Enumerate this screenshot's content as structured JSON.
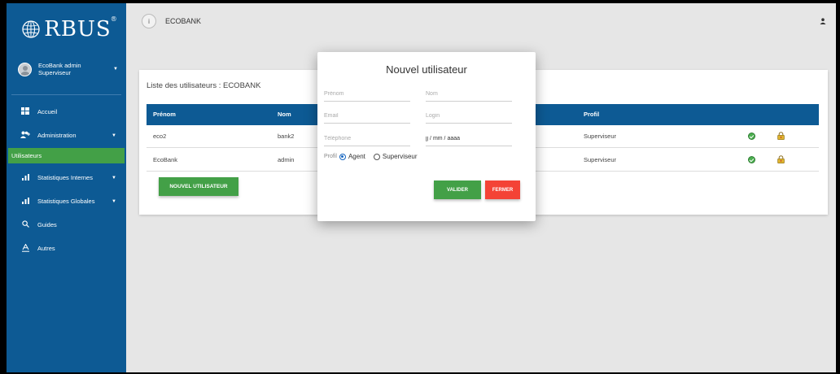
{
  "brand": {
    "logo_text": "RBUS",
    "trademark": "®"
  },
  "user": {
    "name": "EcoBank admin",
    "role": "Superviseur"
  },
  "sidebar": {
    "items": [
      {
        "label": "Accueil"
      },
      {
        "label": "Administration"
      },
      {
        "label": "Utilisateurs"
      },
      {
        "label": "Statistiques Internes"
      },
      {
        "label": "Statistiques Globales"
      },
      {
        "label": "Guides"
      },
      {
        "label": "Autres"
      }
    ]
  },
  "topbar": {
    "info": "i",
    "title": "ECOBANK"
  },
  "card": {
    "title": "Liste des utilisateurs : ECOBANK",
    "columns": [
      "Prénom",
      "Nom",
      "Profil"
    ],
    "rows": [
      {
        "prenom": "eco2",
        "nom": "bank2",
        "profil": "Superviseur"
      },
      {
        "prenom": "EcoBank",
        "nom": "admin",
        "profil": "Superviseur"
      }
    ],
    "new_button": "NOUVEL UTILISATEUR"
  },
  "modal": {
    "title": "Nouvel utilisateur",
    "prenom_placeholder": "Prénom",
    "nom_placeholder": "Nom",
    "email_placeholder": "Email",
    "login_placeholder": "Login",
    "telephone_placeholder": "Téléphone",
    "date_placeholder": "jj / mm / aaaa",
    "profil_label": "Profil",
    "options": [
      "Agent",
      "Superviseur"
    ],
    "selected": "Agent",
    "valider": "VALIDER",
    "fermer": "FERMER"
  },
  "colors": {
    "sidebar": "#0d5a94",
    "accent_green": "#43a047",
    "danger_red": "#f44336"
  }
}
